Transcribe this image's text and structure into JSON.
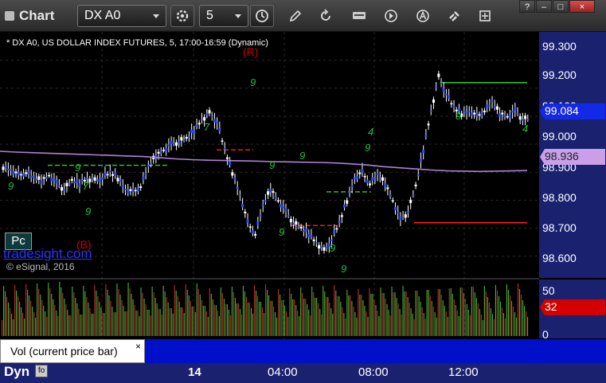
{
  "toolbar": {
    "title": "Chart",
    "symbol": "DX A0",
    "interval": "5",
    "window_controls": [
      "?",
      "–",
      "□",
      "×"
    ]
  },
  "chart_data": {
    "type": "candlestick",
    "title": "* DX A0, US DOLLAR INDEX FUTURES, 5, 17:00-16:59 (Dynamic)",
    "y_ticks": [
      "99.300",
      "99.200",
      "99.100",
      "99.000",
      "98.900",
      "98.800",
      "98.700",
      "98.600"
    ],
    "ylim": [
      98.56,
      99.35
    ],
    "x_ticks": [
      "14",
      "04:00",
      "08:00",
      "12:00"
    ],
    "last_price": "99.084",
    "moving_average": "98.936",
    "annotations": [
      "(R)",
      "(B)"
    ],
    "series": [
      {
        "name": "price",
        "values": [
          98.92,
          98.91,
          98.89,
          98.9,
          98.88,
          98.87,
          98.89,
          98.86,
          98.84,
          98.87,
          98.86,
          98.88,
          98.87,
          98.88,
          98.9,
          98.88,
          98.84,
          98.83,
          98.85,
          98.92,
          98.96,
          98.98,
          99.0,
          99.01,
          99.02,
          99.05,
          99.09,
          99.11,
          99.08,
          98.98,
          98.9,
          98.82,
          98.72,
          98.68,
          98.78,
          98.84,
          98.8,
          98.76,
          98.72,
          98.7,
          98.68,
          98.65,
          98.62,
          98.66,
          98.72,
          98.8,
          98.88,
          98.9,
          98.86,
          98.89,
          98.86,
          98.8,
          98.73,
          98.76,
          98.85,
          98.98,
          99.12,
          99.24,
          99.18,
          99.13,
          99.11,
          99.12,
          99.1,
          99.12,
          99.15,
          99.11,
          99.1,
          99.12,
          99.09
        ]
      },
      {
        "name": "ma",
        "values": [
          98.975,
          98.972,
          98.97,
          98.968,
          98.966,
          98.964,
          98.962,
          98.96,
          98.958,
          98.956,
          98.952,
          98.948,
          98.945,
          98.943,
          98.942,
          98.941,
          98.94,
          98.938,
          98.937,
          98.936,
          98.935,
          98.933,
          98.93,
          98.926,
          98.92,
          98.916,
          98.912,
          98.908,
          98.905,
          98.904,
          98.903,
          98.904,
          98.905,
          98.906
        ]
      }
    ]
  },
  "levels": [
    {
      "name": "green-dashed-1",
      "value": 98.925,
      "color": "#2ecc40"
    },
    {
      "name": "red-dashed-1",
      "value": 98.98,
      "color": "#ff2020"
    },
    {
      "name": "green-dashed-2",
      "value": 98.83,
      "color": "#2ecc40"
    },
    {
      "name": "red-dashed-2",
      "value": 98.71,
      "color": "#ff2020"
    },
    {
      "name": "green-solid",
      "value": 99.22,
      "color": "#2ecc40"
    },
    {
      "name": "red-solid",
      "value": 98.72,
      "color": "#ff2020"
    }
  ],
  "td_counts": [
    "9",
    "9",
    "7",
    "9",
    "9",
    "7",
    "9",
    "9",
    "4",
    "9",
    "9",
    "9",
    "9",
    "9",
    "4"
  ],
  "badges": {
    "pc": "Pc",
    "watermark": "tradesight.com",
    "copyright": "© eSignal, 2016"
  },
  "volume": {
    "legend": "Vol (current price bar)",
    "close_glyph": "×",
    "ticks": [
      "50",
      "0"
    ],
    "current": "32"
  },
  "footer": {
    "label": "Dyn",
    "icon": "fo"
  },
  "colors": {
    "price_tag": "#1428e8",
    "ma_tag": "#c9a0e8",
    "ma_line": "#b080d8",
    "volume_up": "#4caf3a",
    "volume_down": "#b83228",
    "axis_bg": "#1a2270"
  }
}
